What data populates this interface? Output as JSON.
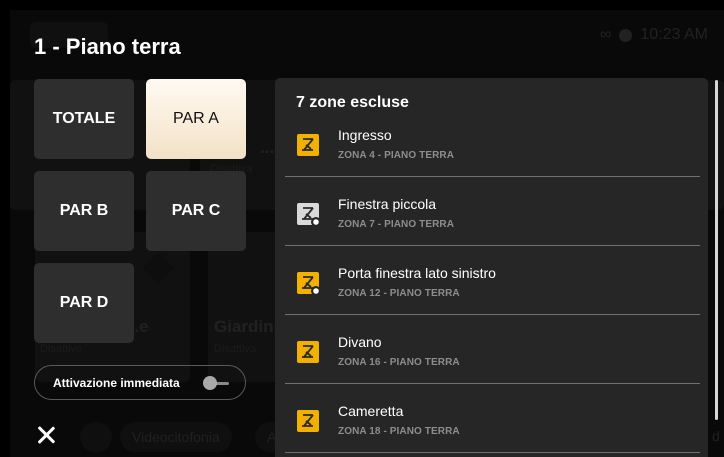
{
  "background": {
    "status_time": "10:23 AM",
    "cards": [
      {
        "title": "...o te",
        "status": "Disattiva"
      },
      {
        "title": "...e",
        "status": "Disattive"
      },
      {
        "title": "Giardin",
        "status": "Disattiva"
      }
    ],
    "nav_pills": [
      "Videocitofonia",
      "A"
    ],
    "corner_text": "d"
  },
  "dialog": {
    "title": "1 - Piano terra",
    "partition_buttons": [
      {
        "label": "TOTALE",
        "active": false
      },
      {
        "label": "PAR A",
        "active": true
      },
      {
        "label": "PAR B",
        "active": false
      },
      {
        "label": "PAR C",
        "active": false
      },
      {
        "label": "PAR D",
        "active": false
      }
    ],
    "immediate_activation": {
      "label": "Attivazione immediata",
      "enabled": false
    },
    "excluded": {
      "title": "7 zone escluse",
      "zones": [
        {
          "name": "Ingresso",
          "sub": "ZONA 4 - PIANO TERRA",
          "icon": "zone-sensor-yellow-icon"
        },
        {
          "name": "Finestra piccola",
          "sub": "ZONA 7 - PIANO TERRA",
          "icon": "zone-sensor-gray-icon"
        },
        {
          "name": "Porta finestra lato sinistro",
          "sub": "ZONA 12 - PIANO TERRA",
          "icon": "zone-sensor-yellow-icon"
        },
        {
          "name": "Divano",
          "sub": "ZONA 16 - PIANO TERRA",
          "icon": "zone-sensor-yellow-icon"
        },
        {
          "name": "Cameretta",
          "sub": "ZONA 18 - PIANO TERRA",
          "icon": "zone-sensor-yellow-icon"
        }
      ]
    }
  },
  "colors": {
    "accent_active": "#f3e1c6",
    "zone_icon_yellow": "#f2b100",
    "zone_icon_gray": "#d9d9d9",
    "panel_bg": "#262626"
  }
}
